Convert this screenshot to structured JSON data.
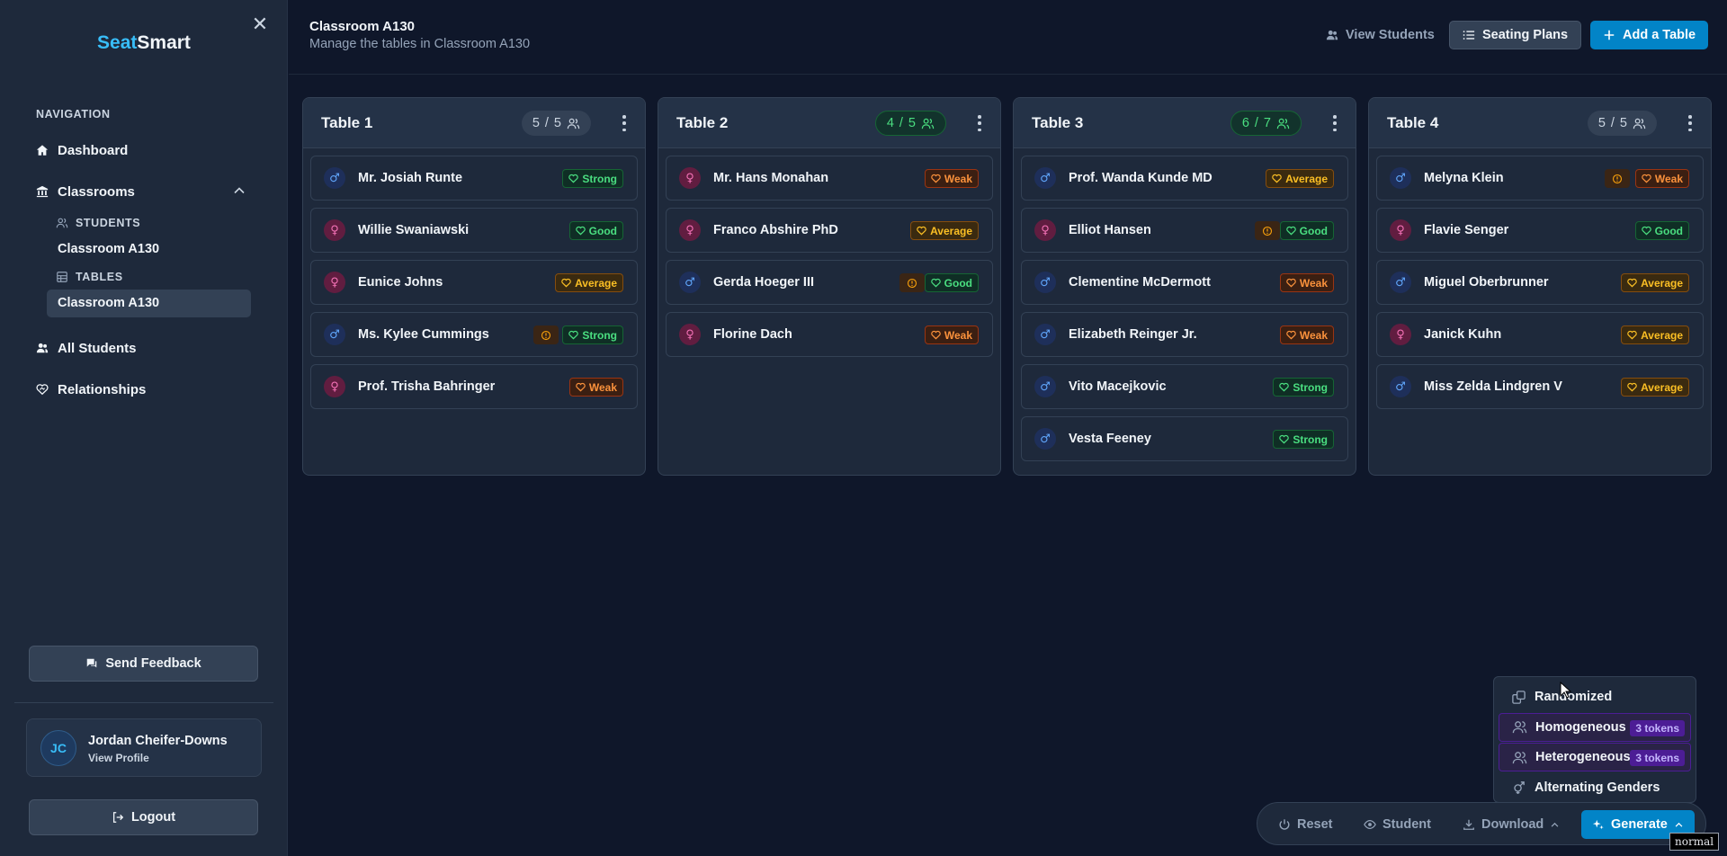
{
  "app": {
    "brand_a": "Seat",
    "brand_b": "Smart",
    "accent_color": "#38bdf8"
  },
  "sidebar": {
    "nav_label": "NAVIGATION",
    "dashboard": "Dashboard",
    "classrooms": "Classrooms",
    "students_section": "STUDENTS",
    "students_classroom": "Classroom A130",
    "tables_section": "TABLES",
    "tables_classroom": "Classroom A130",
    "all_students": "All Students",
    "relationships": "Relationships",
    "feedback": "Send Feedback",
    "profile": {
      "initials": "JC",
      "name": "Jordan Cheifer-Downs",
      "link": "View Profile"
    },
    "logout": "Logout"
  },
  "header": {
    "title": "Classroom A130",
    "subtitle": "Manage the tables in Classroom A130",
    "view_students": "View Students",
    "seating_plans": "Seating Plans",
    "add_table": "Add a Table"
  },
  "tables": [
    {
      "name": "Table 1",
      "count": "5",
      "capacity": "5",
      "status": "full",
      "students": [
        {
          "name": "Mr. Josiah Runte",
          "gender": "male",
          "rel": "Strong",
          "warn": false
        },
        {
          "name": "Willie Swaniawski",
          "gender": "female",
          "rel": "Good",
          "warn": false
        },
        {
          "name": "Eunice Johns",
          "gender": "female",
          "rel": "Average",
          "warn": false
        },
        {
          "name": "Ms. Kylee Cummings",
          "gender": "male",
          "rel": "Strong",
          "warn": true
        },
        {
          "name": "Prof. Trisha Bahringer",
          "gender": "female",
          "rel": "Weak",
          "warn": false
        }
      ]
    },
    {
      "name": "Table 2",
      "count": "4",
      "capacity": "5",
      "status": "open",
      "students": [
        {
          "name": "Mr. Hans Monahan",
          "gender": "female",
          "rel": "Weak",
          "warn": false
        },
        {
          "name": "Franco Abshire PhD",
          "gender": "female",
          "rel": "Average",
          "warn": false
        },
        {
          "name": "Gerda Hoeger III",
          "gender": "male",
          "rel": "Good",
          "warn": true
        },
        {
          "name": "Florine Dach",
          "gender": "female",
          "rel": "Weak",
          "warn": false
        }
      ]
    },
    {
      "name": "Table 3",
      "count": "6",
      "capacity": "7",
      "status": "open",
      "students": [
        {
          "name": "Prof. Wanda Kunde MD",
          "gender": "male",
          "rel": "Average",
          "warn": false
        },
        {
          "name": "Elliot Hansen",
          "gender": "female",
          "rel": "Good",
          "warn": true
        },
        {
          "name": "Clementine McDermott",
          "gender": "male",
          "rel": "Weak",
          "warn": false
        },
        {
          "name": "Elizabeth Reinger Jr.",
          "gender": "male",
          "rel": "Weak",
          "warn": false
        },
        {
          "name": "Vito Macejkovic",
          "gender": "male",
          "rel": "Strong",
          "warn": false
        },
        {
          "name": "Vesta Feeney",
          "gender": "male",
          "rel": "Strong",
          "warn": false
        }
      ]
    },
    {
      "name": "Table 4",
      "count": "5",
      "capacity": "5",
      "status": "full",
      "students": [
        {
          "name": "Melyna Klein",
          "gender": "male",
          "rel": "Weak",
          "warn": true
        },
        {
          "name": "Flavie Senger",
          "gender": "female",
          "rel": "Good",
          "warn": false
        },
        {
          "name": "Miguel Oberbrunner",
          "gender": "male",
          "rel": "Average",
          "warn": false
        },
        {
          "name": "Janick Kuhn",
          "gender": "female",
          "rel": "Average",
          "warn": false
        },
        {
          "name": "Miss Zelda Lindgren V",
          "gender": "male",
          "rel": "Average",
          "warn": false
        }
      ]
    }
  ],
  "generate_menu": {
    "items": [
      {
        "label": "Randomized",
        "icon": "shuffle-icon",
        "tokens": ""
      },
      {
        "label": "Homogeneous",
        "icon": "users-icon",
        "tokens": "3 tokens"
      },
      {
        "label": "Heterogeneous",
        "icon": "users-icon",
        "tokens": "3 tokens"
      },
      {
        "label": "Alternating Genders",
        "icon": "gender-icon",
        "tokens": ""
      }
    ]
  },
  "toolbar": {
    "reset": "Reset",
    "student": "Student",
    "download": "Download",
    "generate": "Generate"
  },
  "mode_tag": "normal"
}
